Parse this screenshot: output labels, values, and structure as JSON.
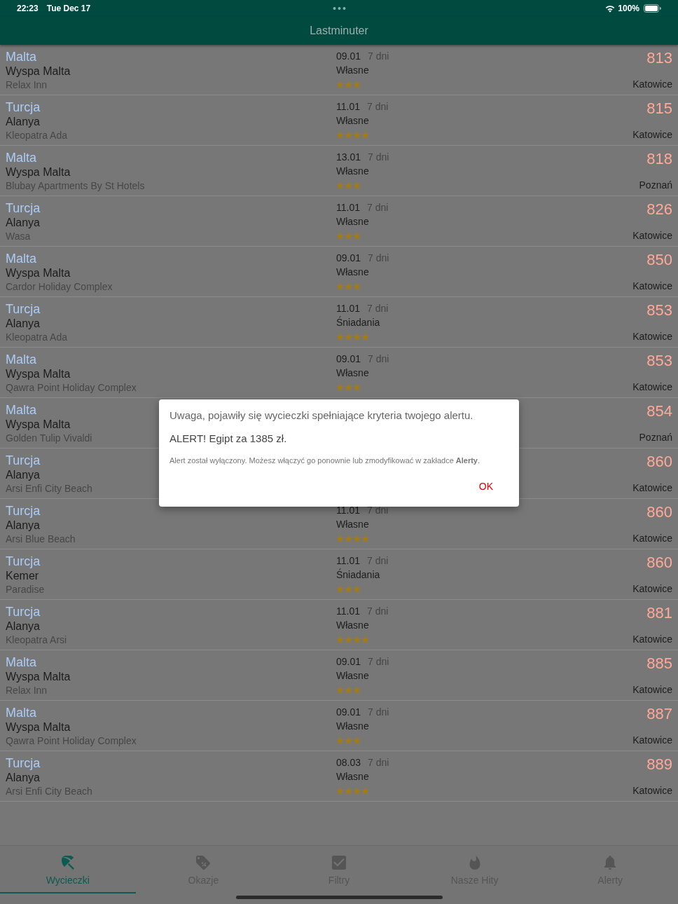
{
  "status_bar": {
    "time": "22:23",
    "date": "Tue Dec 17",
    "battery": "100%"
  },
  "header": {
    "title": "Lastminuter"
  },
  "offers": [
    {
      "country": "Malta",
      "region": "Wyspa Malta",
      "hotel": "Relax Inn",
      "date": "09.01",
      "duration": "7 dni",
      "board": "Własne",
      "stars": 3,
      "price": "813",
      "departure": "Katowice"
    },
    {
      "country": "Turcja",
      "region": "Alanya",
      "hotel": "Kleopatra Ada",
      "date": "11.01",
      "duration": "7 dni",
      "board": "Własne",
      "stars": 4,
      "price": "815",
      "departure": "Katowice"
    },
    {
      "country": "Malta",
      "region": "Wyspa Malta",
      "hotel": "Blubay Apartments By St Hotels",
      "date": "13.01",
      "duration": "7 dni",
      "board": "Własne",
      "stars": 3,
      "price": "818",
      "departure": "Poznań"
    },
    {
      "country": "Turcja",
      "region": "Alanya",
      "hotel": "Wasa",
      "date": "11.01",
      "duration": "7 dni",
      "board": "Własne",
      "stars": 3,
      "price": "826",
      "departure": "Katowice"
    },
    {
      "country": "Malta",
      "region": "Wyspa Malta",
      "hotel": "Cardor Holiday Complex",
      "date": "09.01",
      "duration": "7 dni",
      "board": "Własne",
      "stars": 3,
      "price": "850",
      "departure": "Katowice"
    },
    {
      "country": "Turcja",
      "region": "Alanya",
      "hotel": "Kleopatra Ada",
      "date": "11.01",
      "duration": "7 dni",
      "board": "Śniadania",
      "stars": 4,
      "price": "853",
      "departure": "Katowice"
    },
    {
      "country": "Malta",
      "region": "Wyspa Malta",
      "hotel": "Qawra Point Holiday Complex",
      "date": "09.01",
      "duration": "7 dni",
      "board": "Własne",
      "stars": 3,
      "price": "853",
      "departure": "Katowice"
    },
    {
      "country": "Malta",
      "region": "Wyspa Malta",
      "hotel": "Golden Tulip Vivaldi",
      "price": "854",
      "departure": "Poznań"
    },
    {
      "country": "Turcja",
      "region": "Alanya",
      "hotel": "Arsi Enfi City Beach",
      "price": "860",
      "departure": "Katowice"
    },
    {
      "country": "Turcja",
      "region": "Alanya",
      "hotel": "Arsi Blue Beach",
      "date": "11.01",
      "duration": "7 dni",
      "board": "Własne",
      "stars": 4,
      "price": "860",
      "departure": "Katowice"
    },
    {
      "country": "Turcja",
      "region": "Kemer",
      "hotel": "Paradise",
      "date": "11.01",
      "duration": "7 dni",
      "board": "Śniadania",
      "stars": 3,
      "price": "860",
      "departure": "Katowice"
    },
    {
      "country": "Turcja",
      "region": "Alanya",
      "hotel": "Kleopatra Arsi",
      "date": "11.01",
      "duration": "7 dni",
      "board": "Własne",
      "stars": 4,
      "price": "881",
      "departure": "Katowice"
    },
    {
      "country": "Malta",
      "region": "Wyspa Malta",
      "hotel": "Relax Inn",
      "date": "09.01",
      "duration": "7 dni",
      "board": "Własne",
      "stars": 3,
      "price": "885",
      "departure": "Katowice"
    },
    {
      "country": "Malta",
      "region": "Wyspa Malta",
      "hotel": "Qawra Point Holiday Complex",
      "date": "09.01",
      "duration": "7 dni",
      "board": "Własne",
      "stars": 3,
      "price": "887",
      "departure": "Katowice"
    },
    {
      "country": "Turcja",
      "region": "Alanya",
      "hotel": "Arsi Enfi City Beach",
      "date": "08.03",
      "duration": "7 dni",
      "board": "Własne",
      "stars": 4,
      "price": "889",
      "departure": "Katowice"
    }
  ],
  "dialog": {
    "message": "Uwaga, pojawiły się wycieczki spełniające kryteria twojego alertu.",
    "alert": "ALERT! Egipt za 1385 zł.",
    "note": "Alert został wyłączony. Możesz włączyć go ponownie lub zmodyfikować w zakładce **Alerty**.",
    "button": "OK"
  },
  "tab_bar": {
    "tabs": [
      {
        "label": "Wycieczki",
        "selected": true
      },
      {
        "label": "Okazje",
        "selected": false
      },
      {
        "label": "Filtry",
        "selected": false
      },
      {
        "label": "Nasze Hity",
        "selected": false
      },
      {
        "label": "Alerty",
        "selected": false
      }
    ]
  }
}
